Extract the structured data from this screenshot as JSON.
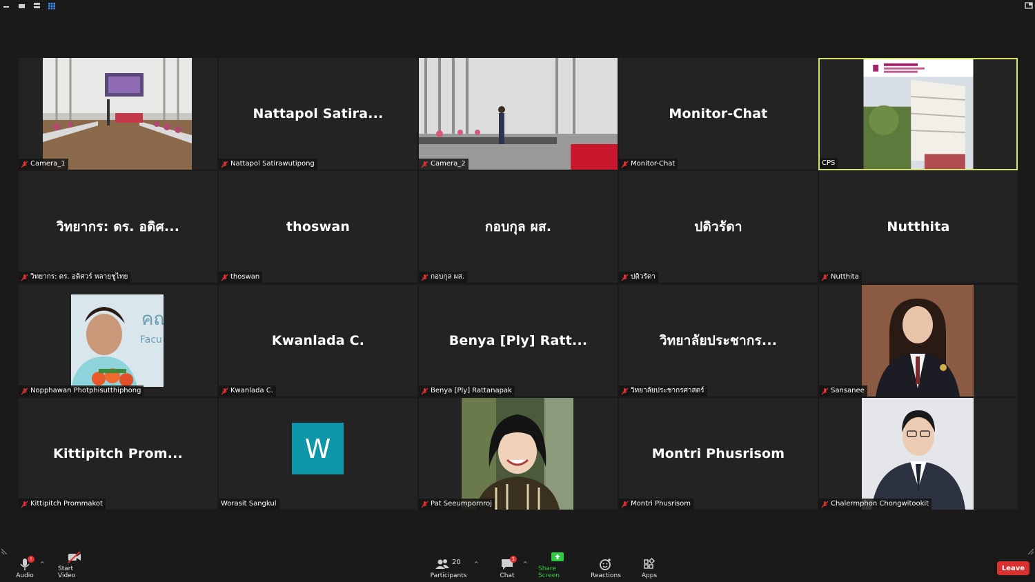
{
  "participants_count": "20",
  "tiles": [
    {
      "label": "Camera_1"
    },
    {
      "big": "Nattapol  Satira...",
      "label": "Nattapol Satirawutipong"
    },
    {
      "label": "Camera_2"
    },
    {
      "big": "Monitor-Chat",
      "label": "Monitor-Chat"
    },
    {
      "label": "CPS"
    },
    {
      "big": "วิทยากร: ดร. อดิศ...",
      "label": "วิทยากร: ดร. อดิศวร์ หลายชูไทย"
    },
    {
      "big": "thoswan",
      "label": "thoswan"
    },
    {
      "big": "กอบกุล ผส.",
      "label": "กอบกุล ผส."
    },
    {
      "big": "ปดิวรัดา",
      "label": "ปดิวรัดา"
    },
    {
      "big": "Nutthita",
      "label": "Nutthita"
    },
    {
      "label": "Nopphawan Photphisutthiphong"
    },
    {
      "big": "Kwanlada C.",
      "label": "Kwanlada C."
    },
    {
      "big": "Benya  [Ply]  Ratt...",
      "label": "Benya [Ply] Rattanapak"
    },
    {
      "big": "วิทยาลัยประชากร...",
      "label": "วิทยาลัยประชากรศาสตร์"
    },
    {
      "label": "Sansanee"
    },
    {
      "big": "Kittipitch  Prom...",
      "label": "Kittipitch Prommakot"
    },
    {
      "avatar_letter": "W",
      "label": "Worasit Sangkul"
    },
    {
      "label": "Pat Seeumpornroj"
    },
    {
      "big": "Montri Phusrisom",
      "label": "Montri Phusrisom"
    },
    {
      "label": "Chalermphon Chongwitookit"
    }
  ],
  "toolbar": {
    "audio": "Audio",
    "start_video": "Start Video",
    "participants": "Participants",
    "chat": "Chat",
    "share_screen": "Share Screen",
    "reactions": "Reactions",
    "apps": "Apps",
    "leave": "Leave",
    "audio_badge": "!",
    "chat_badge": "1"
  },
  "colors": {
    "active_border": "#d6e26a",
    "share_green": "#2ecc40",
    "leave_red": "#d93030",
    "mute_red": "#e03030"
  }
}
